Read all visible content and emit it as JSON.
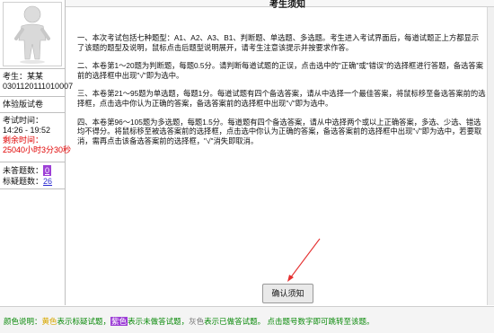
{
  "header": {
    "title": "考生须知"
  },
  "candidate": {
    "label": "考生：",
    "name": "某某",
    "id": "0301120111010007",
    "exam_name": "体验版试卷"
  },
  "timer": {
    "time_label": "考试时间：",
    "time_range": "14:26 - 19:52",
    "remaining_label": "剩余时间：",
    "remaining": "25040小时3分30秒"
  },
  "stats": {
    "unanswered_label": "未答题数：",
    "unanswered": "0",
    "flagged_label": "标疑题数：",
    "flagged": "26"
  },
  "instructions": [
    "一、本次考试包括七种题型：A1、A2、A3、B1、判断题、单选题、多选题。考生进入考试界面后，每道试题正上方都显示了该题的题型及说明，鼠标点击后题型说明展开，请考生注意该提示并按要求作答。",
    "二、本卷第1～20题为判断题，每题0.5分。请判断每道试题的正误，点击选中的\"正确\"或\"错误\"的选择框进行答题，备选答案前的选择框中出现\"√\"即为选中。",
    "三、本卷第21～95题为单选题，每题1分。每道试题有四个备选答案，请从中选择一个最佳答案，将鼠标移至备选答案前的选择框，点击选中你认为正确的答案，备选答案前的选择框中出现\"√\"即为选中。",
    "四、本卷第96～105题为多选题，每题1.5分。每道题有四个备选答案，请从中选择两个或以上正确答案，多选、少选、错选均不得分。将鼠标移至被选答案前的选择框，点击选中你认为正确的答案，备选答案前的选择框中出现\"√\"即为选中，若要取消，需再点击该备选答案前的选择框，\"√\"消失即取消。"
  ],
  "buttons": {
    "confirm": "确认须知"
  },
  "footer": {
    "p1": "颜色说明：",
    "p2": "黄色",
    "p3": "表示标疑试题，",
    "p4": "紫色",
    "p5": "表示未做答试题，",
    "p6": "灰色",
    "p7": "表示已做答试题。",
    "p8": " 点击题号数字即可跳转至该题。"
  },
  "colors": {
    "flagged": "#d8a800",
    "unanswered": "#9d3fd6",
    "remaining_time": "#e00000",
    "hint": "#0a8a0a",
    "arrow": "#e53030"
  },
  "icons": {
    "avatar": "person-figure-icon",
    "annotation": "red-arrow-icon"
  }
}
